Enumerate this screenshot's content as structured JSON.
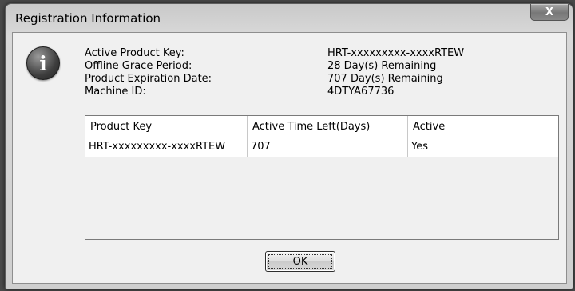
{
  "window": {
    "title": "Registration Information",
    "close_glyph": "X"
  },
  "info": {
    "icon": "information-icon",
    "icon_glyph": "i",
    "fields": [
      {
        "label": "Active Product Key:",
        "value": "HRT-xxxxxxxxx-xxxxRTEW"
      },
      {
        "label": "Offline Grace Period:",
        "value": "28 Day(s) Remaining"
      },
      {
        "label": "Product Expiration Date:",
        "value": "707 Day(s) Remaining"
      },
      {
        "label": "Machine ID:",
        "value": "4DTYA67736"
      }
    ]
  },
  "table": {
    "columns": [
      "Product Key",
      "Active Time Left(Days)",
      "Active"
    ],
    "rows": [
      [
        "HRT-xxxxxxxxx-xxxxRTEW",
        "707",
        "Yes"
      ]
    ]
  },
  "buttons": {
    "ok_label": "OK"
  }
}
